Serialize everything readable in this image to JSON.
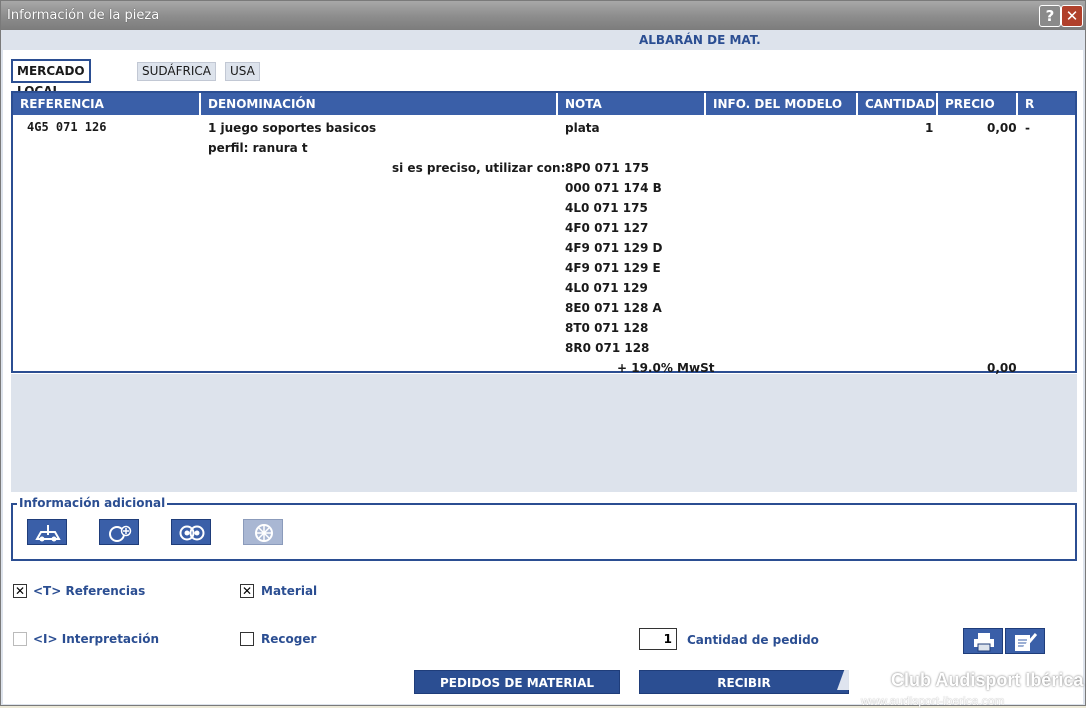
{
  "window": {
    "title": "Información de la pieza",
    "help_glyph": "?",
    "close_glyph": "✕"
  },
  "header": {
    "doc_type": "ALBARÁN DE MAT."
  },
  "tabs": [
    {
      "label": "MERCADO LOCAL",
      "active": true
    },
    {
      "label": "SUDÁFRICA",
      "active": false
    },
    {
      "label": "USA",
      "active": false
    }
  ],
  "table": {
    "columns": [
      "REFERENCIA",
      "DENOMINACIÓN",
      "NOTA",
      "INFO. DEL MODELO",
      "CANTIDAD",
      "PRECIO",
      "R"
    ],
    "row": {
      "referencia": "4G5 071 126",
      "denominacion_1": "1 juego soportes basicos",
      "denominacion_2": "perfil: ranura t",
      "nota": "plata",
      "cantidad": "1",
      "precio": "0,00",
      "r": "-"
    },
    "alt_label": "si es preciso, utilizar con:",
    "alternatives": [
      "8P0 071 175",
      "000 071 174 B",
      "4L0 071 175",
      "4F0 071 127",
      "4F9 071 129 D",
      "4F9 071 129 E",
      "4L0 071 129",
      "8E0 071 128 A",
      "8T0 071 128",
      "8R0 071 128"
    ],
    "tax_label": "+ 19.0% MwSt",
    "tax_value": "0,00"
  },
  "additional": {
    "legend": "Información adicional",
    "icons": [
      "car-lift-icon",
      "wheel-plus-icon",
      "rims-icon",
      "tire-star-icon"
    ]
  },
  "options": {
    "referencias": {
      "label": "<T> Referencias",
      "checked": true
    },
    "material": {
      "label": "Material",
      "checked": true
    },
    "interpretacion": {
      "label": "<I> Interpretación",
      "checked": false,
      "disabled": true
    },
    "recoger": {
      "label": "Recoger",
      "checked": false
    }
  },
  "order": {
    "quantity": "1",
    "quantity_label": "Cantidad de pedido"
  },
  "buttons": {
    "pedidos": "PEDIDOS DE MATERIAL",
    "recibir": "RECIBIR"
  },
  "watermark": {
    "line1": "Club Audisport Ibérica",
    "line2": "www.audisport-iberica.com"
  },
  "colors": {
    "accent": "#2b4e92",
    "header": "#3a5fa8",
    "panel": "#dde3ec"
  }
}
